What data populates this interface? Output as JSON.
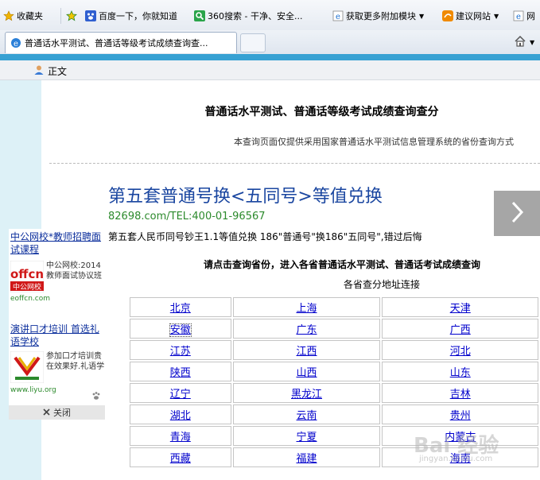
{
  "favbar": {
    "favorites": "收藏夹",
    "items": [
      "百度一下，你就知道",
      "360搜索 - 干净、安全...",
      "获取更多附加模块",
      "建议网站",
      "网"
    ]
  },
  "tab": {
    "title": "普通话水平测试、普通话等级考试成绩查询查..."
  },
  "page": {
    "user_link": "正文",
    "title": "普通话水平测试、普通话等级考试成绩查询查分",
    "subtitle": "本查询页面仅提供采用国家普通话水平测试信息管理系统的省份查询方式",
    "ad": {
      "title": "第五套普通号换<五同号>等值兑换",
      "phone": "82698.com/TEL:400-01-96567",
      "desc": "第五套人民币同号钞王1.1等值兑换 186\"普通号\"换186\"五同号\",错过后悔"
    },
    "query_head": "请点击查询省份，进入各省普通话水平测试、普通话考试成绩查询",
    "query_sub": "各省查分地址连接",
    "provinces": [
      [
        "北京",
        "上海",
        "天津"
      ],
      [
        "安徽",
        "广东",
        "广西"
      ],
      [
        "江苏",
        "江西",
        "河北"
      ],
      [
        "陕西",
        "山西",
        "山东"
      ],
      [
        "辽宁",
        "黑龙江",
        "吉林"
      ],
      [
        "湖北",
        "云南",
        "贵州"
      ],
      [
        "青海",
        "宁夏",
        "内蒙古"
      ],
      [
        "西藏",
        "福建",
        "海南"
      ]
    ]
  },
  "floating_ad": {
    "ad1_title": "中公网校*教师招聘面试课程",
    "ad1_text": "中公网校:2014教师面试协议班",
    "ad1_logo": "offcn 中公网校",
    "ad1_url": "eoffcn.com",
    "ad2_title": "演讲口才培训 首选礼语学校",
    "ad2_text": "参加口才培训贵在效果好.礼语学",
    "ad2_url": "www.liyu.org",
    "close": "关闭"
  },
  "watermark": {
    "main": "Bai 经验",
    "sub": "jingyan.baidu.com"
  },
  "colors": {
    "link": "#0000cc",
    "accent_stripe": "#37a1d3",
    "ad_title": "#1a46a0",
    "ad_url": "#2c8a2c"
  }
}
